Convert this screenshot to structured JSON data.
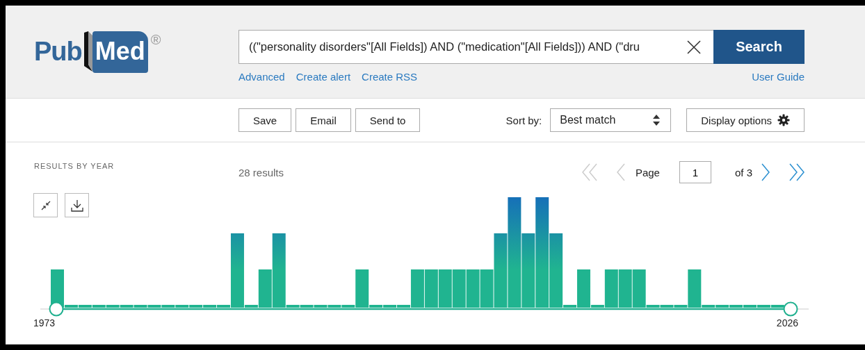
{
  "logo": {
    "first": "Pub",
    "second": "Med",
    "mark": "®"
  },
  "search": {
    "value": "((\"personality disorders\"[All Fields]) AND (\"medication\"[All Fields])) AND (\"dru",
    "button": "Search"
  },
  "links": [
    "Advanced",
    "Create alert",
    "Create RSS"
  ],
  "user_guide": "User Guide",
  "actions": [
    "Save",
    "Email",
    "Send to"
  ],
  "sort": {
    "label": "Sort by:",
    "value": "Best match"
  },
  "display_options": "Display options",
  "timeline": {
    "title": "RESULTS BY YEAR",
    "start_year": "1973",
    "end_year": "2026"
  },
  "results_count": "28 results",
  "pagination": {
    "label": "Page",
    "value": "1",
    "total": "of 3"
  }
}
